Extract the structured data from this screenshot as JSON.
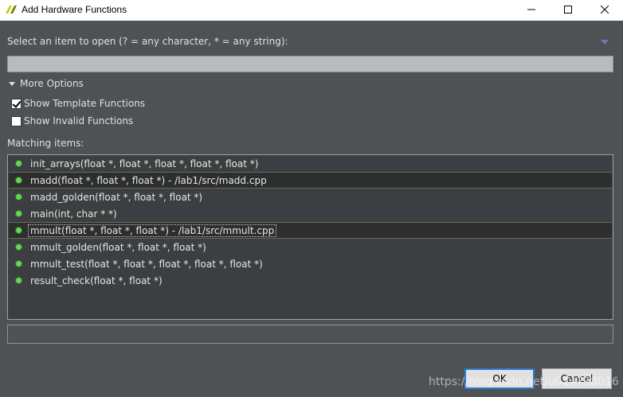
{
  "window": {
    "title": "Add Hardware Functions",
    "icons": [
      "app-logo-icon",
      "minimize-icon",
      "maximize-icon",
      "close-icon"
    ]
  },
  "prompt": {
    "label": "Select an item to open (? = any character, * = any string):",
    "filter_value": ""
  },
  "options": {
    "toggle_label": "More Options",
    "show_template_label": "Show Template Functions",
    "show_template_checked": true,
    "show_invalid_label": "Show Invalid Functions",
    "show_invalid_checked": false
  },
  "matching": {
    "label": "Matching items:",
    "items": [
      "init_arrays(float *, float *, float *, float *, float *)",
      "madd(float *, float *, float *) - /lab1/src/madd.cpp",
      "madd_golden(float *, float *, float *)",
      "main(int, char * *)",
      "mmult(float *, float *, float *) - /lab1/src/mmult.cpp",
      "mmult_golden(float *, float *, float *)",
      "mmult_test(float *, float *, float *, float *, float *)",
      "result_check(float *, float *)"
    ]
  },
  "buttons": {
    "ok": "OK",
    "cancel": "Cancel"
  },
  "watermark": "https://blog.csdn.net/u014798016",
  "colors": {
    "dialog_bg": "#4e5254",
    "list_bg": "#3c3f41",
    "status_dot": "#6fd15a",
    "focus_border": "#2d7ad6"
  }
}
